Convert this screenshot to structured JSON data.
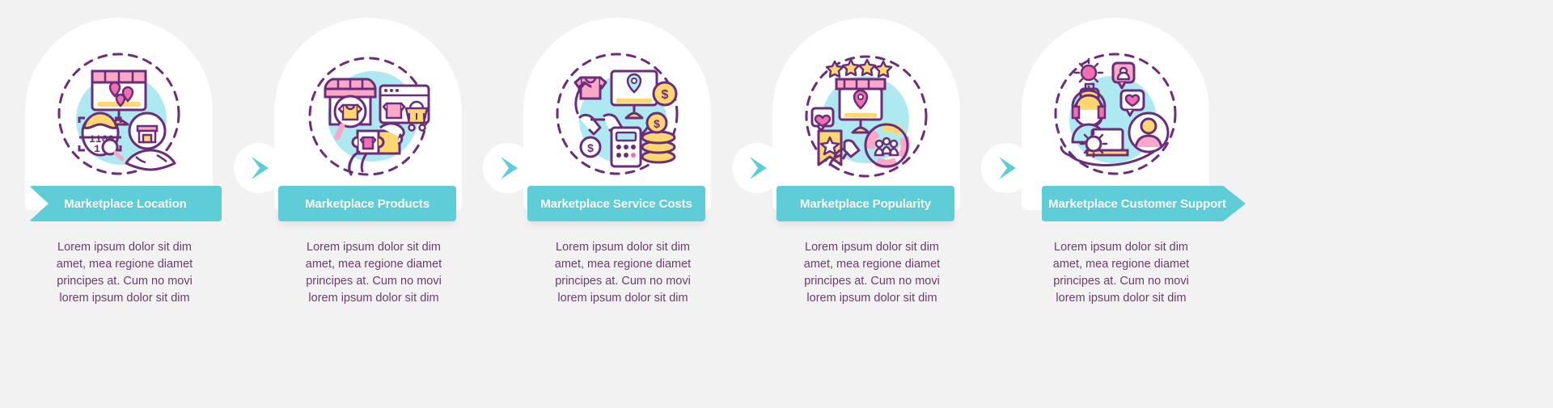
{
  "page": {
    "background_color": "#f2f2f2",
    "accent_color": "#5ecdd8",
    "text_color": "#6b3c6e",
    "card_color": "#ffffff",
    "icon_circle_color": "#aee9f2"
  },
  "connector": {
    "icon": "chevron-right-icon",
    "color": "#5ecdd8",
    "count": 4
  },
  "steps": [
    {
      "title_line1": "Marketplace",
      "title_line2": "Location",
      "icon": "marketplace-location-icon",
      "body": [
        "Lorem ipsum dolor sit dim",
        "amet, mea regione diamet",
        "principes at. Cum no movi",
        "lorem ipsum dolor sit dim"
      ]
    },
    {
      "title_line1": "Marketplace",
      "title_line2": "Products",
      "icon": "marketplace-products-icon",
      "body": [
        "Lorem ipsum dolor sit dim",
        "amet, mea regione diamet",
        "principes at. Cum no movi",
        "lorem ipsum dolor sit dim"
      ]
    },
    {
      "title_line1": "Marketplace Service",
      "title_line2": "Costs",
      "icon": "marketplace-service-costs-icon",
      "body": [
        "Lorem ipsum dolor sit dim",
        "amet, mea regione diamet",
        "principes at. Cum no movi",
        "lorem ipsum dolor sit dim"
      ]
    },
    {
      "title_line1": "Marketplace",
      "title_line2": "Popularity",
      "icon": "marketplace-popularity-icon",
      "body": [
        "Lorem ipsum dolor sit dim",
        "amet, mea regione diamet",
        "principes at. Cum no movi",
        "lorem ipsum dolor sit dim"
      ]
    },
    {
      "title_line1": "Marketplace Customer",
      "title_line2": "Support",
      "icon": "marketplace-customer-support-icon",
      "body": [
        "Lorem ipsum dolor sit dim",
        "amet, mea regione diamet",
        "principes at. Cum no movi",
        "lorem ipsum dolor sit dim"
      ]
    }
  ]
}
